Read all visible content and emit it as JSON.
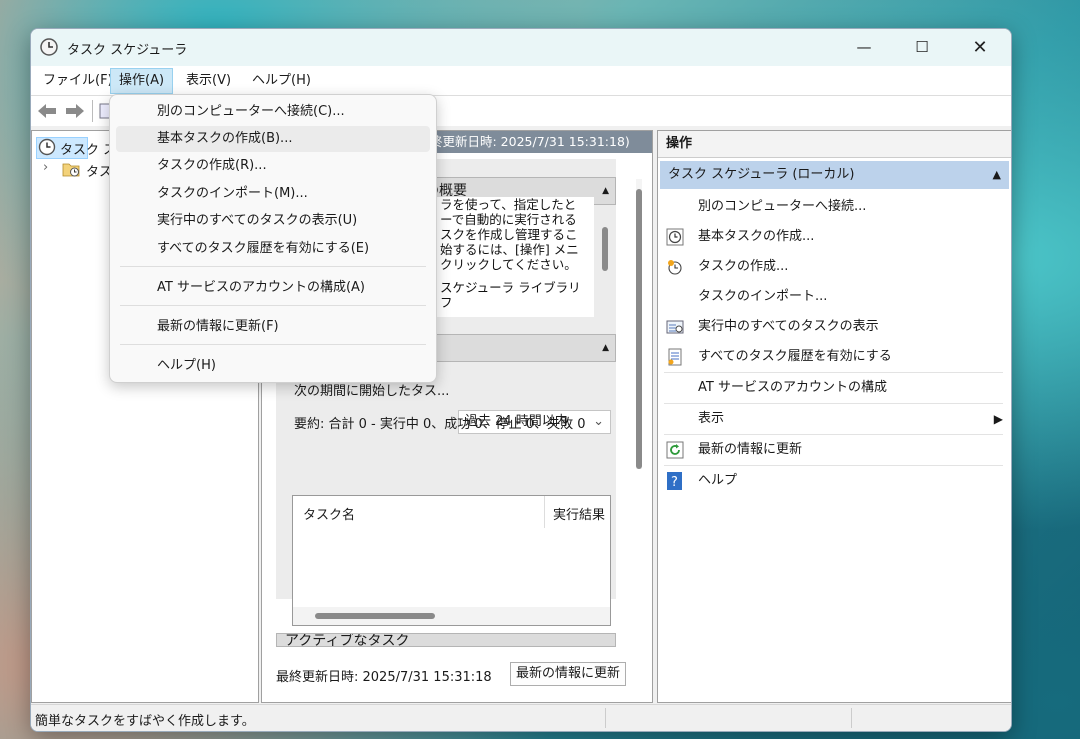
{
  "window": {
    "title": "タスク スケジューラ"
  },
  "menubar": [
    "ファイル(F)",
    "操作(A)",
    "表示(V)",
    "ヘルプ(H)"
  ],
  "tree": {
    "root_label": "タスク ス",
    "child_label": "タス"
  },
  "center": {
    "header": "終更新日時: 2025/7/31 15:31:18)",
    "overview_title": "の概要",
    "overview_text": [
      "ラを使って、指定したと",
      "ーで自動的に実行される",
      "スクを作成し管理するこ",
      "始するには、[操作] メニ",
      "クリックしてください。",
      "スケジューラ ライブラリ フ"
    ],
    "status_row_label": "次の期間に開始したタス...",
    "period_select": "過去 24 時間以内",
    "summary": "要約: 合計 0 - 実行中 0、成功 0、停止 0、失敗 0",
    "grid_headers": [
      "タスク名",
      "実行結果"
    ],
    "active_tasks_title": "アクティブなタスク",
    "last_updated": "最終更新日時: 2025/7/31 15:31:18",
    "refresh_button": "最新の情報に更新"
  },
  "actions": {
    "title": "操作",
    "group": "タスク スケジューラ (ローカル)",
    "items": [
      {
        "label": "別のコンピューターへ接続...",
        "icon": "none"
      },
      {
        "label": "基本タスクの作成...",
        "icon": "clock-icon"
      },
      {
        "label": "タスクの作成...",
        "icon": "task-icon"
      },
      {
        "label": "タスクのインポート...",
        "icon": "none"
      },
      {
        "label": "実行中のすべてのタスクの表示",
        "icon": "running-tasks-icon"
      },
      {
        "label": "すべてのタスク履歴を有効にする",
        "icon": "history-icon"
      },
      {
        "label": "AT サービスのアカウントの構成",
        "icon": "none"
      },
      {
        "label": "表示",
        "icon": "none"
      },
      {
        "label": "最新の情報に更新",
        "icon": "refresh-icon"
      },
      {
        "label": "ヘルプ",
        "icon": "help-icon"
      }
    ]
  },
  "popup_menu": {
    "items": [
      "別のコンピューターへ接続(C)...",
      "基本タスクの作成(B)...",
      "タスクの作成(R)...",
      "タスクのインポート(M)...",
      "実行中のすべてのタスクの表示(U)",
      "すべてのタスク履歴を有効にする(E)",
      "AT サービスのアカウントの構成(A)",
      "最新の情報に更新(F)",
      "ヘルプ(H)"
    ]
  },
  "statusbar": {
    "text": "簡単なタスクをすばやく作成します。"
  },
  "colors": {
    "accent": "#bcd2eb",
    "header_gray": "#7f8c9a",
    "menu_active": "#cde8f7"
  }
}
